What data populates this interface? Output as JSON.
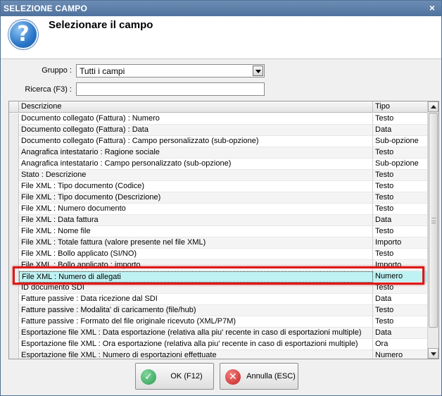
{
  "window": {
    "title": "SELEZIONE CAMPO",
    "close_glyph": "×"
  },
  "header": {
    "title": "Selezionare il campo",
    "icon": "question-icon"
  },
  "form": {
    "gruppo_label": "Gruppo :",
    "gruppo_value": "Tutti i campi",
    "ricerca_label": "Ricerca (F3) :",
    "ricerca_value": ""
  },
  "table": {
    "columns": [
      "Descrizione",
      "Tipo"
    ],
    "rows": [
      {
        "desc": "Documento collegato (Fattura) : Numero",
        "tipo": "Testo"
      },
      {
        "desc": "Documento collegato (Fattura) : Data",
        "tipo": "Data"
      },
      {
        "desc": "Documento collegato (Fattura) : Campo personalizzato (sub-opzione)",
        "tipo": "Sub-opzione"
      },
      {
        "desc": "Anagrafica intestatario : Ragione sociale",
        "tipo": "Testo"
      },
      {
        "desc": "Anagrafica intestatario : Campo personalizzato (sub-opzione)",
        "tipo": "Sub-opzione"
      },
      {
        "desc": "Stato : Descrizione",
        "tipo": "Testo"
      },
      {
        "desc": "File XML : Tipo documento (Codice)",
        "tipo": "Testo"
      },
      {
        "desc": "File XML : Tipo documento (Descrizione)",
        "tipo": "Testo"
      },
      {
        "desc": "File XML : Numero documento",
        "tipo": "Testo"
      },
      {
        "desc": "File XML : Data fattura",
        "tipo": "Data"
      },
      {
        "desc": "File XML : Nome file",
        "tipo": "Testo"
      },
      {
        "desc": "File XML : Totale fattura (valore presente nel file XML)",
        "tipo": "Importo"
      },
      {
        "desc": "File XML : Bollo applicato (SI/NO)",
        "tipo": "Testo"
      },
      {
        "desc": "File XML : Bollo applicato : importo",
        "tipo": "Importo"
      },
      {
        "desc": "File XML : Numero di allegati",
        "tipo": "Numero"
      },
      {
        "desc": "ID documento SDI",
        "tipo": "Testo"
      },
      {
        "desc": "Fatture passive : Data ricezione dal SDI",
        "tipo": "Data"
      },
      {
        "desc": "Fatture passive : Modalita' di caricamento (file/hub)",
        "tipo": "Testo"
      },
      {
        "desc": "Fatture passive : Formato del file originale ricevuto (XML/P7M)",
        "tipo": "Testo"
      },
      {
        "desc": "Esportazione file XML : Data esportazione (relativa alla piu' recente in caso di esportazioni multiple)",
        "tipo": "Data"
      },
      {
        "desc": "Esportazione file XML : Ora esportazione (relativa alla piu' recente in caso di esportazioni multiple)",
        "tipo": "Ora"
      },
      {
        "desc": "Esportazione file XML : Numero di esportazioni effettuate",
        "tipo": "Numero"
      }
    ],
    "selected_index": 14
  },
  "buttons": {
    "ok_label": "OK (F12)",
    "cancel_label": "Annulla (ESC)"
  },
  "colors": {
    "titlebar": "#5b7ea8",
    "selected_row": "#bff2f2",
    "highlight_border": "#e01818"
  }
}
